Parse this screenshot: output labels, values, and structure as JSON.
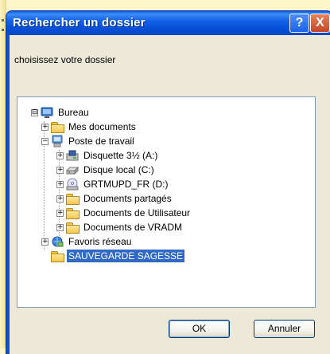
{
  "dialog": {
    "title": "Rechercher un dossier",
    "help_label": "?",
    "close_label": "X",
    "prompt": "choisissez votre dossier"
  },
  "tree": [
    {
      "label": "Bureau",
      "icon": "desktop-icon",
      "expander": "⊟"
    },
    {
      "label": "Mes documents",
      "icon": "folder-icon",
      "expander": "+"
    },
    {
      "label": "Poste de travail",
      "icon": "computer-icon",
      "expander": "−"
    },
    {
      "label": "Disquette 3½ (A:)",
      "icon": "floppy-drive-icon",
      "expander": "+"
    },
    {
      "label": "Disque local (C:)",
      "icon": "hard-drive-icon",
      "expander": "+"
    },
    {
      "label": "GRTMUPD_FR (D:)",
      "icon": "cd-drive-icon",
      "expander": "+"
    },
    {
      "label": "Documents partagés",
      "icon": "folder-icon",
      "expander": "+"
    },
    {
      "label": "Documents de Utilisateur",
      "icon": "folder-icon",
      "expander": "+"
    },
    {
      "label": "Documents de VRADM",
      "icon": "folder-icon",
      "expander": "+"
    },
    {
      "label": "Favoris réseau",
      "icon": "network-places-icon",
      "expander": "+"
    },
    {
      "label": "SAUVEGARDE SAGESSE",
      "icon": "folder-icon",
      "selected": true
    }
  ],
  "buttons": {
    "ok": "OK",
    "cancel": "Annuler"
  },
  "colors": {
    "title_bar": "#0a52d6",
    "selection": "#316ac5",
    "dialog_face": "#ece9d8",
    "background": "#fdf6c8"
  }
}
